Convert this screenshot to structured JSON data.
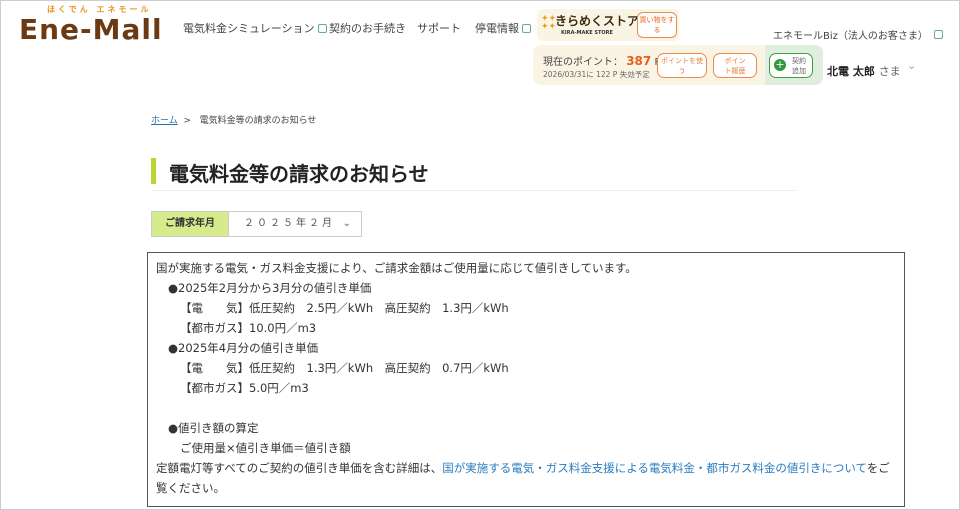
{
  "header": {
    "logo_sub": "ほくでん エネモール",
    "logo": "Ene-Mall",
    "nav": [
      "電気料金シミュレーション",
      "契約のお手続き",
      "サポート",
      "停電情報"
    ],
    "store": {
      "name": "きらめくストア",
      "sub": "KIRA-MAKE STORE",
      "button": "買い物をする"
    },
    "biz_link": "エネモールBiz（法人のお客さま）",
    "points": {
      "label": "現在のポイント：",
      "value": "387",
      "unit": "P",
      "expiry": "2026/03/31に 122 P 失効予定",
      "use_button": "ポイントを使う",
      "history_button": "ポイント履歴",
      "add_contract_button": "契約追加"
    },
    "user": {
      "name": "北電 太郎",
      "suffix": "さま"
    }
  },
  "breadcrumb": {
    "home": "ホーム",
    "sep": ">",
    "current": "電気料金等の請求のお知らせ"
  },
  "page_title": "電気料金等の請求のお知らせ",
  "billing_month": {
    "label": "ご請求年月",
    "value": "２０２５年２月"
  },
  "notice": {
    "lines": [
      "国が実施する電気・ガス料金支援により、ご請求金額はご使用量に応じて値引きしています。",
      "●2025年2月分から3月分の値引き単価",
      "【電　　気】低圧契約　2.5円／kWh　高圧契約　1.3円／kWh",
      "【都市ガス】10.0円／m3",
      "●2025年4月分の値引き単価",
      "【電　　気】低圧契約　1.3円／kWh　高圧契約　0.7円／kWh",
      "【都市ガス】5.0円／m3",
      "●値引き額の算定",
      "ご使用量×値引き単価＝値引き額"
    ],
    "detail_prefix": "定額電灯等すべてのご契約の値引き単価を含む詳細は、",
    "detail_link": "国が実施する電気・ガス料金支援による電気料金・都市ガス料金の値引きについて",
    "detail_suffix": "をご覧ください。"
  },
  "colors": {
    "accent_green": "#b8d830",
    "orange": "#e8601a",
    "link": "#2a7cc0",
    "brand_brown": "#6b3a12"
  }
}
